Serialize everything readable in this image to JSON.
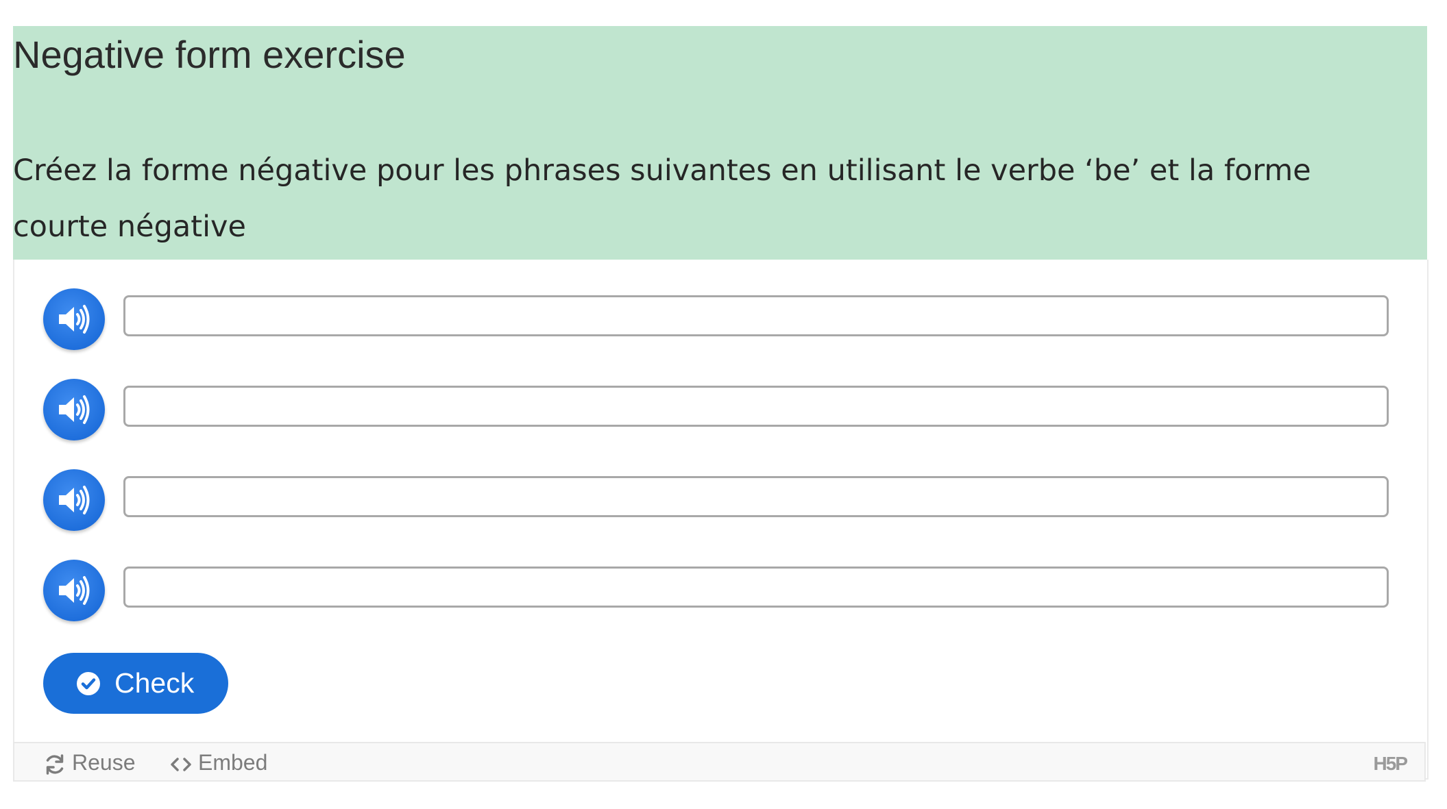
{
  "header": {
    "title": "Negative form exercise",
    "instructions": "Créez la forme négative pour les phrases suivantes en utilisant le verbe ‘be’ et la forme courte négative",
    "background_color": "#c0e5cf"
  },
  "exercise": {
    "items": [
      {
        "audio_icon": "speaker-icon",
        "value": ""
      },
      {
        "audio_icon": "speaker-icon",
        "value": ""
      },
      {
        "audio_icon": "speaker-icon",
        "value": ""
      },
      {
        "audio_icon": "speaker-icon",
        "value": ""
      }
    ],
    "check_label": "Check",
    "accent_color": "#1a6fd8"
  },
  "footer": {
    "reuse_label": "Reuse",
    "embed_label": "Embed",
    "logo_text": "H5P"
  }
}
